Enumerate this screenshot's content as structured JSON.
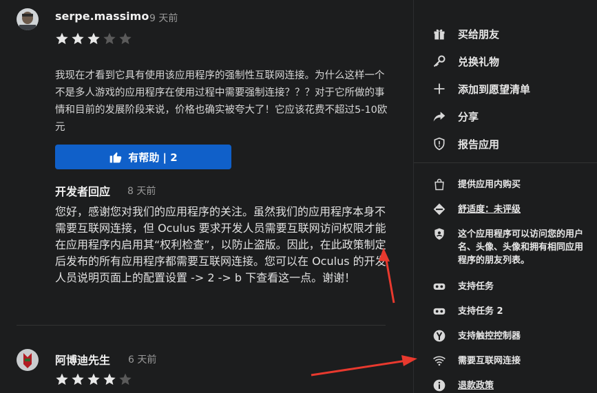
{
  "reviews": [
    {
      "username": "serpe.massimo",
      "time": "9 天前",
      "stars": 3,
      "text": "我现在才看到它具有使用该应用程序的强制性互联网连接。为什么这样一个不是多人游戏的应用程序在使用过程中需要强制连接？？？对于它所做的事情和目前的发展阶段来说，价格也确实被夸大了！它应该花费不超过5-10欧元",
      "helpful_label": "有帮助 | 2",
      "developer_reply": {
        "title": "开发者回应",
        "time": "8 天前",
        "text": "您好，感谢您对我们的应用程序的关注。虽然我们的应用程序本身不需要互联网连接，但 Oculus 要求开发人员需要互联网访问权限才能在应用程序内启用其“权利检查”，以防止盗版。因此，在此政策制定后发布的所有应用程序都需要互联网连接。您可以在 Oculus 的开发人员说明页面上的配置设置 -> 2 -> b 下查看这一点。谢谢！"
      }
    },
    {
      "username": "阿博迪先生",
      "time": "6 天前",
      "stars": 4
    }
  ],
  "actions": [
    {
      "label": "买给朋友",
      "icon": "gift-icon"
    },
    {
      "label": "兑换礼物",
      "icon": "key-icon"
    },
    {
      "label": "添加到愿望清单",
      "icon": "plus-icon"
    },
    {
      "label": "分享",
      "icon": "share-icon"
    },
    {
      "label": "报告应用",
      "icon": "shield-alert-icon"
    }
  ],
  "info": [
    {
      "label": "提供应用内购买",
      "icon": "shopping-bag-icon"
    },
    {
      "label": "舒适度：未评级",
      "icon": "comfort-icon"
    },
    {
      "label": "这个应用程序可以访问您的用户名、头像、头像和拥有相同应用程序的朋友列表。",
      "icon": "privacy-shield-icon"
    },
    {
      "label": "支持任务",
      "icon": "vr-headset-icon"
    },
    {
      "label": "支持任务 2",
      "icon": "vr-headset-icon"
    },
    {
      "label": "支持触控控制器",
      "icon": "controller-icon"
    },
    {
      "label": "需要互联网连接",
      "icon": "wifi-icon"
    },
    {
      "label": "退款政策",
      "icon": "info-icon"
    }
  ],
  "colors": {
    "background": "#1c1d1e",
    "helpful_button": "#1060c9",
    "star_filled": "#e8e8e8",
    "star_empty": "#5a5a5a",
    "annotation_arrow": "#e8392e"
  }
}
